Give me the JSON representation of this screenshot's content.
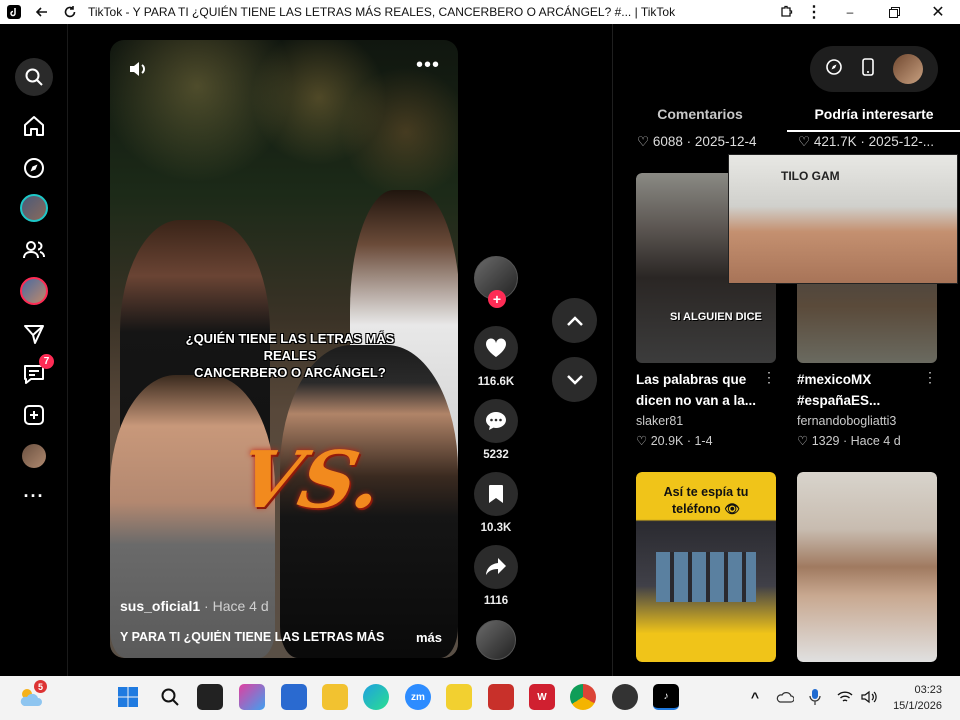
{
  "window": {
    "title": "TikTok - Y PARA TI ¿QUIÉN TIENE LAS LETRAS MÁS REALES, CANCERBERO O ARCÁNGEL? #... | TikTok"
  },
  "sidebar": {
    "messages_badge": "7"
  },
  "video": {
    "overlay_text_line1": "¿QUIÉN TIENE LAS LETRAS MÁS REALES",
    "overlay_text_line2": "CANCERBERO O ARCÁNGEL?",
    "vs_text": "VS.",
    "author": "sus_oficial1",
    "time": "· Hace 4 d",
    "description": "Y PARA TI ¿QUIÉN TIENE LAS LETRAS MÁS",
    "more_label": "más"
  },
  "actions": {
    "likes": "116.6K",
    "comments": "5232",
    "saves": "10.3K",
    "shares": "1116"
  },
  "right_panel": {
    "tabs": [
      "Comentarios",
      "Podría interesarte"
    ],
    "active_tab": "Podría interesarte",
    "top_stats": [
      {
        "likes": "6088",
        "date": "2025-12-4"
      },
      {
        "likes": "421.7K",
        "date": "2025-12-..."
      }
    ],
    "cards": [
      {
        "title": "Las palabras que dicen no van a la...",
        "author": "slaker81",
        "likes": "20.9K",
        "date": "1-4",
        "caption": "SI ALGUIEN DICE"
      },
      {
        "title": "#mexicoMX #españaES...",
        "author": "fernandobogliatti3",
        "likes": "1329",
        "date": "Hace 4 d"
      },
      {
        "caption": "Así te espía tu teléfono 👁"
      },
      {}
    ],
    "webcam_text": "TILO GAM"
  },
  "taskbar": {
    "weather_badge": "5",
    "time": "03:23",
    "date": "15/1/2026"
  }
}
